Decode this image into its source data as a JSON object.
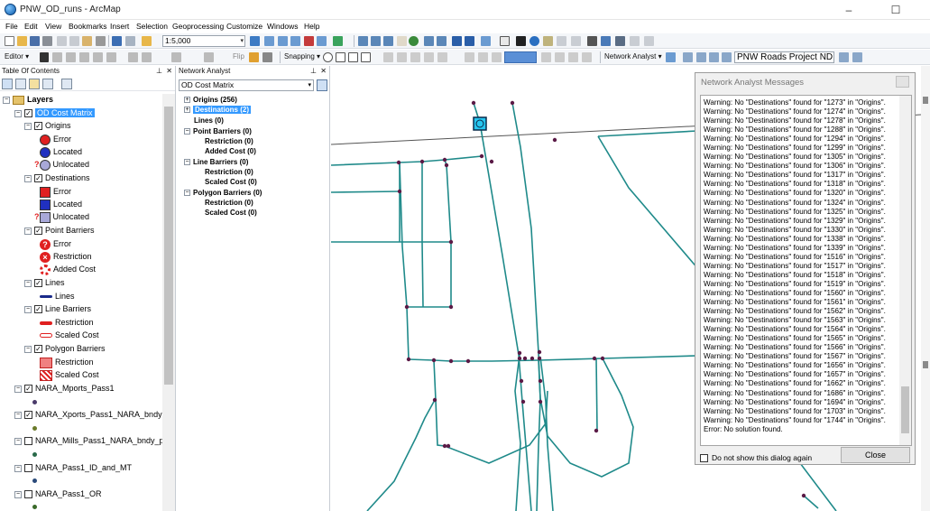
{
  "window": {
    "title": "PNW_OD_runs - ArcMap",
    "min": "–",
    "max": "☐",
    "close": "✕"
  },
  "menu": [
    "File",
    "Edit",
    "View",
    "Bookmarks",
    "Insert",
    "Selection",
    "Geoprocessing",
    "Customize",
    "Windows",
    "Help"
  ],
  "toolbar": {
    "scale": "1:5,000",
    "editor": "Editor ▾",
    "flip": "Flip",
    "snapping": "Snapping ▾",
    "network_analyst": "Network Analyst ▾",
    "network_dataset": "PNW Roads Project ND",
    "zoom_value": ""
  },
  "toc": {
    "title": "Table Of Contents",
    "items": [
      {
        "label": "Layers"
      },
      {
        "label": "OD Cost Matrix"
      },
      {
        "label": "Origins"
      },
      {
        "label": "Error"
      },
      {
        "label": "Located"
      },
      {
        "label": "Unlocated"
      },
      {
        "label": "Destinations"
      },
      {
        "label": "Error"
      },
      {
        "label": "Located"
      },
      {
        "label": "Unlocated"
      },
      {
        "label": "Point Barriers"
      },
      {
        "label": "Error"
      },
      {
        "label": "Restriction"
      },
      {
        "label": "Added Cost"
      },
      {
        "label": "Lines"
      },
      {
        "label": "Lines"
      },
      {
        "label": "Line Barriers"
      },
      {
        "label": "Restriction"
      },
      {
        "label": "Scaled Cost"
      },
      {
        "label": "Polygon Barriers"
      },
      {
        "label": "Restriction"
      },
      {
        "label": "Scaled Cost"
      },
      {
        "label": "NARA_Mports_Pass1"
      },
      {
        "label": "NARA_Xports_Pass1_NARA_bndy"
      },
      {
        "label": "NARA_Mills_Pass1_NARA_bndy_pr"
      },
      {
        "label": "NARA_Pass1_ID_and_MT"
      },
      {
        "label": "NARA_Pass1_OR"
      }
    ]
  },
  "network_analyst": {
    "title": "Network Analyst",
    "selected": "OD Cost Matrix",
    "items": [
      {
        "label": "Origins (256)"
      },
      {
        "label": "Destinations (2)"
      },
      {
        "label": "Lines (0)"
      },
      {
        "label": "Point Barriers (0)"
      },
      {
        "label": "Restriction (0)"
      },
      {
        "label": "Added Cost (0)"
      },
      {
        "label": "Line Barriers (0)"
      },
      {
        "label": "Restriction (0)"
      },
      {
        "label": "Scaled Cost (0)"
      },
      {
        "label": "Polygon Barriers (0)"
      },
      {
        "label": "Restriction (0)"
      },
      {
        "label": "Scaled Cost (0)"
      }
    ]
  },
  "dialog": {
    "title": "Network Analyst Messages",
    "messages": [
      "Warning: No \"Destinations\" found for \"1273\" in \"Origins\".",
      "Warning: No \"Destinations\" found for \"1274\" in \"Origins\".",
      "Warning: No \"Destinations\" found for \"1278\" in \"Origins\".",
      "Warning: No \"Destinations\" found for \"1288\" in \"Origins\".",
      "Warning: No \"Destinations\" found for \"1294\" in \"Origins\".",
      "Warning: No \"Destinations\" found for \"1299\" in \"Origins\".",
      "Warning: No \"Destinations\" found for \"1305\" in \"Origins\".",
      "Warning: No \"Destinations\" found for \"1306\" in \"Origins\".",
      "Warning: No \"Destinations\" found for \"1317\" in \"Origins\".",
      "Warning: No \"Destinations\" found for \"1318\" in \"Origins\".",
      "Warning: No \"Destinations\" found for \"1320\" in \"Origins\".",
      "Warning: No \"Destinations\" found for \"1324\" in \"Origins\".",
      "Warning: No \"Destinations\" found for \"1325\" in \"Origins\".",
      "Warning: No \"Destinations\" found for \"1329\" in \"Origins\".",
      "Warning: No \"Destinations\" found for \"1330\" in \"Origins\".",
      "Warning: No \"Destinations\" found for \"1338\" in \"Origins\".",
      "Warning: No \"Destinations\" found for \"1339\" in \"Origins\".",
      "Warning: No \"Destinations\" found for \"1516\" in \"Origins\".",
      "Warning: No \"Destinations\" found for \"1517\" in \"Origins\".",
      "Warning: No \"Destinations\" found for \"1518\" in \"Origins\".",
      "Warning: No \"Destinations\" found for \"1519\" in \"Origins\".",
      "Warning: No \"Destinations\" found for \"1560\" in \"Origins\".",
      "Warning: No \"Destinations\" found for \"1561\" in \"Origins\".",
      "Warning: No \"Destinations\" found for \"1562\" in \"Origins\".",
      "Warning: No \"Destinations\" found for \"1563\" in \"Origins\".",
      "Warning: No \"Destinations\" found for \"1564\" in \"Origins\".",
      "Warning: No \"Destinations\" found for \"1565\" in \"Origins\".",
      "Warning: No \"Destinations\" found for \"1566\" in \"Origins\".",
      "Warning: No \"Destinations\" found for \"1567\" in \"Origins\".",
      "Warning: No \"Destinations\" found for \"1656\" in \"Origins\".",
      "Warning: No \"Destinations\" found for \"1657\" in \"Origins\".",
      "Warning: No \"Destinations\" found for \"1662\" in \"Origins\".",
      "Warning: No \"Destinations\" found for \"1686\" in \"Origins\".",
      "Warning: No \"Destinations\" found for \"1694\" in \"Origins\".",
      "Warning: No \"Destinations\" found for \"1703\" in \"Origins\".",
      "Warning: No \"Destinations\" found for \"1744\" in \"Origins\".",
      "Error: No solution found."
    ],
    "checkbox": "Do not show this dialog again",
    "close": "Close"
  },
  "colors": {
    "road": "#1f8a8a",
    "node": "#5a1a46",
    "origin": "#26c6f0",
    "selection": "#3399ff"
  }
}
